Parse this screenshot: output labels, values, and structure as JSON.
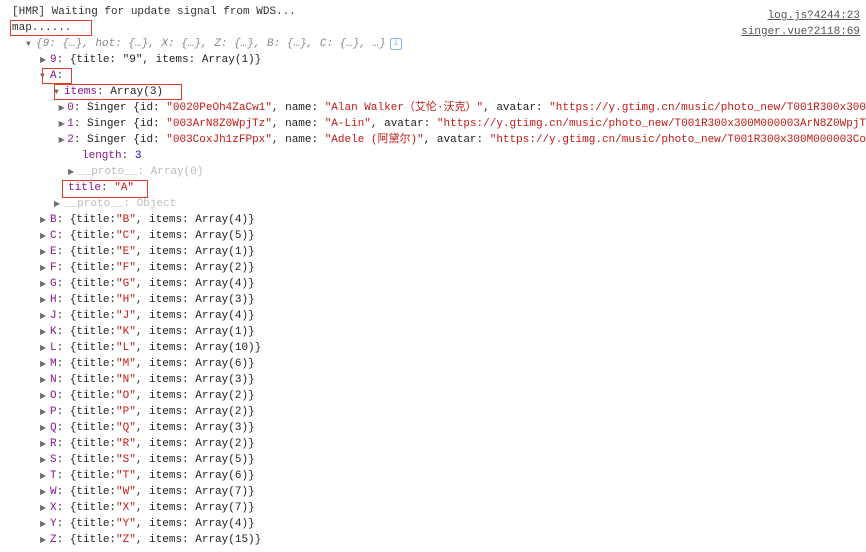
{
  "links": {
    "log": "log.js?4244:23",
    "singer": "singer.vue?2118:69"
  },
  "lines": {
    "hmr": "[HMR] Waiting for update signal from WDS...",
    "map": "map......",
    "summary_prefix": "{9: {…}, hot: {…}, X: {…}, Z: {…}, B: {…}, C: {…}, …}",
    "obj9_key": "9",
    "obj9_body": "{title: \"9\", items: Array(1)}",
    "A_key": "A",
    "A_items_key": "items",
    "A_items_val": "Array(3)",
    "A_title_key": "title",
    "A_title_val": "\"A\"",
    "length_key": "length",
    "length_val": "3",
    "proto_key": "__proto__",
    "proto_arr": "Array(0)",
    "proto_obj": "Object"
  },
  "singers": [
    {
      "idx": "0",
      "cls": "Singer",
      "id": "\"0020PeOh4ZaCw1\"",
      "name": "\"Alan Walker（艾伦·沃克）\"",
      "avatar": "\"https://y.gtimg.cn/music/photo_new/T001R300x300"
    },
    {
      "idx": "1",
      "cls": "Singer",
      "id": "\"003ArN8Z0WpjTz\"",
      "name": "\"A-Lin\"",
      "avatar": "\"https://y.gtimg.cn/music/photo_new/T001R300x300M000003ArN8Z0WpjT"
    },
    {
      "idx": "2",
      "cls": "Singer",
      "id": "\"003CoxJh1zFPpx\"",
      "name": "\"Adele (阿黛尔)\"",
      "avatar": "\"https://y.gtimg.cn/music/photo_new/T001R300x300M000003Co"
    }
  ],
  "letters": [
    {
      "k": "B",
      "t": "\"B\"",
      "n": "4"
    },
    {
      "k": "C",
      "t": "\"C\"",
      "n": "5"
    },
    {
      "k": "E",
      "t": "\"E\"",
      "n": "1"
    },
    {
      "k": "F",
      "t": "\"F\"",
      "n": "2"
    },
    {
      "k": "G",
      "t": "\"G\"",
      "n": "4"
    },
    {
      "k": "H",
      "t": "\"H\"",
      "n": "3"
    },
    {
      "k": "J",
      "t": "\"J\"",
      "n": "4"
    },
    {
      "k": "K",
      "t": "\"K\"",
      "n": "1"
    },
    {
      "k": "L",
      "t": "\"L\"",
      "n": "10"
    },
    {
      "k": "M",
      "t": "\"M\"",
      "n": "6"
    },
    {
      "k": "N",
      "t": "\"N\"",
      "n": "3"
    },
    {
      "k": "O",
      "t": "\"O\"",
      "n": "2"
    },
    {
      "k": "P",
      "t": "\"P\"",
      "n": "2"
    },
    {
      "k": "Q",
      "t": "\"Q\"",
      "n": "3"
    },
    {
      "k": "R",
      "t": "\"R\"",
      "n": "2"
    },
    {
      "k": "S",
      "t": "\"S\"",
      "n": "5"
    },
    {
      "k": "T",
      "t": "\"T\"",
      "n": "6"
    },
    {
      "k": "W",
      "t": "\"W\"",
      "n": "7"
    },
    {
      "k": "X",
      "t": "\"X\"",
      "n": "7"
    },
    {
      "k": "Y",
      "t": "\"Y\"",
      "n": "4"
    },
    {
      "k": "Z",
      "t": "\"Z\"",
      "n": "15"
    }
  ]
}
